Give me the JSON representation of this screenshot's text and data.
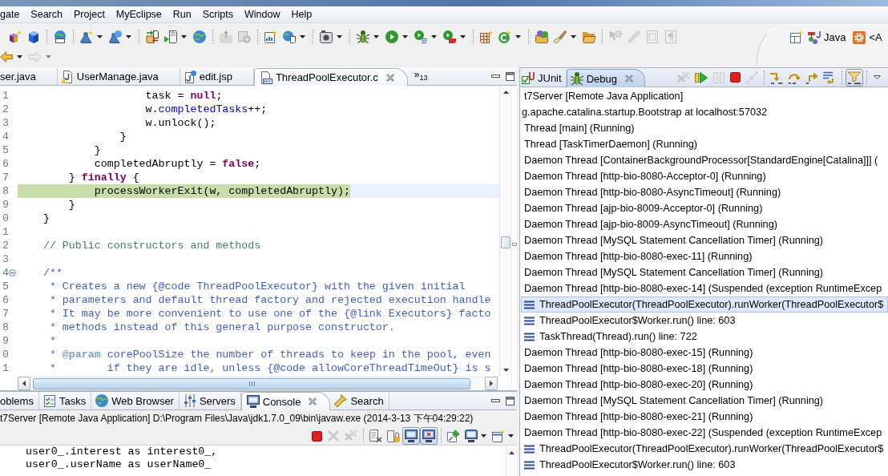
{
  "menu_bar": {
    "items": [
      "gate",
      "Search",
      "Project",
      "MyEclipse",
      "Run",
      "Scripts",
      "Window",
      "Help"
    ]
  },
  "main_toolbar": {
    "groups": [
      [
        {
          "disabled": false,
          "dropdown": false
        },
        {
          "disabled": false,
          "dropdown": false
        }
      ],
      [
        {
          "disabled": false,
          "dropdown": false
        }
      ],
      [
        {
          "disabled": false,
          "dropdown": true
        },
        {
          "disabled": false,
          "dropdown": true
        }
      ],
      [
        {
          "disabled": false,
          "dropdown": false
        },
        {
          "disabled": false,
          "dropdown": true
        },
        {
          "disabled": false,
          "dropdown": false
        }
      ],
      [
        {
          "disabled": true,
          "dropdown": false
        },
        {
          "disabled": true,
          "dropdown": false
        }
      ],
      [
        {
          "disabled": false,
          "dropdown": false
        },
        {
          "disabled": false,
          "dropdown": true
        }
      ],
      [
        {
          "disabled": false,
          "dropdown": true
        }
      ],
      [
        {
          "disabled": false,
          "dropdown": true
        },
        {
          "disabled": false,
          "dropdown": true
        },
        {
          "disabled": false,
          "dropdown": true
        },
        {
          "disabled": false,
          "dropdown": true
        }
      ],
      [
        {
          "disabled": false,
          "dropdown": false
        },
        {
          "disabled": false,
          "dropdown": true
        }
      ],
      [
        {
          "disabled": false,
          "dropdown": false
        },
        {
          "disabled": false,
          "dropdown": true
        },
        {
          "disabled": false,
          "dropdown": false
        }
      ],
      [
        {
          "disabled": true,
          "dropdown": false
        },
        {
          "disabled": true,
          "dropdown": false
        },
        {
          "disabled": true,
          "dropdown": false
        },
        {
          "disabled": true,
          "dropdown": false
        }
      ]
    ]
  },
  "navigation_toolbar": {
    "items": [
      {
        "disabled": false,
        "dropdown": true
      },
      {
        "disabled": true,
        "dropdown": true
      }
    ]
  },
  "perspective_bar": {
    "perspectives": [
      {
        "label": "Java"
      },
      {
        "label": "<A"
      }
    ]
  },
  "editor": {
    "tabs": [
      {
        "label": "ser.java",
        "selected": false
      },
      {
        "label": "UserManage.java",
        "selected": false
      },
      {
        "label": "edit.jsp",
        "selected": false
      },
      {
        "label": "ThreadPoolExecutor.c",
        "selected": true
      }
    ],
    "overflow": "»$_{13}$",
    "lines": [
      {
        "number": "1",
        "debug_highlight": false,
        "segments": [
          {
            "kind": "plain",
            "text": "                    task = "
          },
          {
            "kind": "keyword",
            "text": "null"
          },
          {
            "kind": "plain",
            "text": ";"
          }
        ]
      },
      {
        "number": "2",
        "debug_highlight": false,
        "segments": [
          {
            "kind": "plain",
            "text": "                    w."
          },
          {
            "kind": "field",
            "text": "completedTasks"
          },
          {
            "kind": "plain",
            "text": "++;"
          }
        ]
      },
      {
        "number": "3",
        "debug_highlight": false,
        "segments": [
          {
            "kind": "plain",
            "text": "                    w.unlock();"
          }
        ]
      },
      {
        "number": "4",
        "debug_highlight": false,
        "segments": [
          {
            "kind": "plain",
            "text": "                }"
          }
        ]
      },
      {
        "number": "5",
        "debug_highlight": false,
        "segments": [
          {
            "kind": "plain",
            "text": "            }"
          }
        ]
      },
      {
        "number": "6",
        "debug_highlight": false,
        "segments": [
          {
            "kind": "plain",
            "text": "            completedAbruptly = "
          },
          {
            "kind": "keyword",
            "text": "false"
          },
          {
            "kind": "plain",
            "text": ";"
          }
        ]
      },
      {
        "number": "7",
        "debug_highlight": false,
        "segments": [
          {
            "kind": "plain",
            "text": "        } "
          },
          {
            "kind": "keyword",
            "text": "finally"
          },
          {
            "kind": "plain",
            "text": " {"
          }
        ]
      },
      {
        "number": "8",
        "debug_highlight": true,
        "segments": [
          {
            "kind": "plain",
            "text": "            processWorkerExit(w, completedAbruptly);"
          }
        ]
      },
      {
        "number": "9",
        "debug_highlight": false,
        "segments": [
          {
            "kind": "plain",
            "text": "        }"
          }
        ]
      },
      {
        "number": "0",
        "debug_highlight": false,
        "segments": [
          {
            "kind": "plain",
            "text": "    }"
          }
        ]
      },
      {
        "number": "1",
        "debug_highlight": false
      },
      {
        "number": "2",
        "debug_highlight": false,
        "segments": [
          {
            "kind": "comment",
            "text": "    // Public constructors and methods"
          }
        ]
      },
      {
        "number": "3",
        "debug_highlight": false
      },
      {
        "number": "4",
        "debug_highlight": false,
        "fold_expanded": true,
        "segments": [
          {
            "kind": "javadoc",
            "text": "    /**"
          }
        ]
      },
      {
        "number": "5",
        "debug_highlight": false,
        "segments": [
          {
            "kind": "javadoc",
            "text": "     * Creates a new {@code ThreadPoolExecutor} with the given initial"
          }
        ]
      },
      {
        "number": "6",
        "debug_highlight": false,
        "segments": [
          {
            "kind": "javadoc",
            "text": "     * parameters and default thread factory and rejected execution handle"
          }
        ]
      },
      {
        "number": "7",
        "debug_highlight": false,
        "segments": [
          {
            "kind": "javadoc",
            "text": "     * It may be more convenient to use one of the {@link Executors} facto"
          }
        ]
      },
      {
        "number": "8",
        "debug_highlight": false,
        "segments": [
          {
            "kind": "javadoc",
            "text": "     * methods instead of this general purpose constructor."
          }
        ]
      },
      {
        "number": "9",
        "debug_highlight": false,
        "segments": [
          {
            "kind": "javadoc",
            "text": "     *"
          }
        ]
      },
      {
        "number": "0",
        "debug_highlight": false,
        "segments": [
          {
            "kind": "javadoc",
            "text": "     * "
          },
          {
            "kind": "javadoc_tag",
            "text": "@param"
          },
          {
            "kind": "javadoc",
            "text": " corePoolSize the number of threads to keep in the pool, even"
          }
        ]
      },
      {
        "number": "1",
        "debug_highlight": false,
        "segments": [
          {
            "kind": "javadoc",
            "text": "     *        if they are idle, unless {@code allowCoreThreadTimeOut} is s"
          }
        ]
      }
    ]
  },
  "debug_view": {
    "tabs": [
      {
        "label": "JUnit",
        "selected": false
      },
      {
        "label": "Debug",
        "selected": true
      }
    ],
    "toolbar": {
      "groups": [
        [
          {
            "disabled": true,
            "pressed": false
          },
          {
            "disabled": false,
            "pressed": false
          },
          {
            "disabled": true,
            "pressed": false
          },
          {
            "disabled": false,
            "pressed": false
          },
          {
            "disabled": true,
            "pressed": false
          }
        ],
        [
          {
            "disabled": false,
            "pressed": false
          },
          {
            "disabled": false,
            "pressed": false
          },
          {
            "disabled": false,
            "pressed": false
          },
          {
            "disabled": false,
            "pressed": false
          }
        ],
        [
          {
            "disabled": false,
            "pressed": true
          }
        ]
      ]
    },
    "tree": [
      {
        "kind": "launch",
        "label": "t7Server [Remote Java Application]",
        "selected": false,
        "children": [
          {
            "kind": "target",
            "label": "g.apache.catalina.startup.Bootstrap at localhost:57032",
            "selected": false,
            "children": [
              {
                "kind": "thread",
                "label": "Thread [main] (Running)",
                "selected": false
              },
              {
                "kind": "thread",
                "label": "Thread [TaskTimerDaemon] (Running)",
                "selected": false
              },
              {
                "kind": "thread",
                "label": "Daemon Thread [ContainerBackgroundProcessor[StandardEngine[Catalina]]] (",
                "selected": false
              },
              {
                "kind": "thread",
                "label": "Daemon Thread [http-bio-8080-Acceptor-0] (Running)",
                "selected": false
              },
              {
                "kind": "thread",
                "label": "Daemon Thread [http-bio-8080-AsyncTimeout] (Running)",
                "selected": false
              },
              {
                "kind": "thread",
                "label": "Daemon Thread [ajp-bio-8009-Acceptor-0] (Running)",
                "selected": false
              },
              {
                "kind": "thread",
                "label": "Daemon Thread [ajp-bio-8009-AsyncTimeout] (Running)",
                "selected": false
              },
              {
                "kind": "thread",
                "label": "Daemon Thread [MySQL Statement Cancellation Timer] (Running)",
                "selected": false
              },
              {
                "kind": "thread",
                "label": "Daemon Thread [http-bio-8080-exec-11] (Running)",
                "selected": false
              },
              {
                "kind": "thread",
                "label": "Daemon Thread [MySQL Statement Cancellation Timer] (Running)",
                "selected": false
              },
              {
                "kind": "thread",
                "label": "Daemon Thread [http-bio-8080-exec-14] (Suspended (exception RuntimeExcep",
                "selected": false,
                "children": [
                  {
                    "kind": "frame",
                    "label": "ThreadPoolExecutor(ThreadPoolExecutor).runWorker(ThreadPoolExecutor$",
                    "selected": true
                  },
                  {
                    "kind": "frame",
                    "label": "ThreadPoolExecutor$Worker.run() line: 603",
                    "selected": false
                  },
                  {
                    "kind": "frame",
                    "label": "TaskThread(Thread).run() line: 722",
                    "selected": false
                  }
                ]
              },
              {
                "kind": "thread",
                "label": "Daemon Thread [http-bio-8080-exec-15] (Running)",
                "selected": false
              },
              {
                "kind": "thread",
                "label": "Daemon Thread [http-bio-8080-exec-18] (Running)",
                "selected": false
              },
              {
                "kind": "thread",
                "label": "Daemon Thread [http-bio-8080-exec-20] (Running)",
                "selected": false
              },
              {
                "kind": "thread",
                "label": "Daemon Thread [MySQL Statement Cancellation Timer] (Running)",
                "selected": false
              },
              {
                "kind": "thread",
                "label": "Daemon Thread [http-bio-8080-exec-21] (Running)",
                "selected": false
              },
              {
                "kind": "thread",
                "label": "Daemon Thread [http-bio-8080-exec-22] (Suspended (exception RuntimeExcep",
                "selected": false,
                "children": [
                  {
                    "kind": "frame",
                    "label": "ThreadPoolExecutor(ThreadPoolExecutor).runWorker(ThreadPoolExecutor$",
                    "selected": false
                  },
                  {
                    "kind": "frame",
                    "label": "ThreadPoolExecutor$Worker.run() line: 603",
                    "selected": false
                  }
                ]
              }
            ]
          }
        ]
      }
    ]
  },
  "console_view": {
    "tabs": [
      {
        "label": "oblems",
        "selected": false
      },
      {
        "label": "Tasks",
        "selected": false
      },
      {
        "label": "Web Browser",
        "selected": false
      },
      {
        "label": "Servers",
        "selected": false
      },
      {
        "label": "Console",
        "selected": true
      },
      {
        "label": "Search",
        "selected": false
      }
    ],
    "process": "t7Server [Remote Java Application] D:\\Program Files\\Java\\jdk1.7.0_09\\bin\\javaw.exe (2014-3-13 下午04:29:22)",
    "toolbar": {
      "groups": [
        [
          {
            "disabled": false,
            "pressed": false,
            "dropdown": false
          },
          {
            "disabled": true,
            "pressed": false,
            "dropdown": false
          },
          {
            "disabled": true,
            "pressed": false,
            "dropdown": false
          }
        ],
        [
          {
            "disabled": false,
            "pressed": false,
            "dropdown": false
          },
          {
            "disabled": false,
            "pressed": false,
            "dropdown": false
          },
          {
            "disabled": false,
            "pressed": true,
            "dropdown": false
          },
          {
            "disabled": false,
            "pressed": true,
            "dropdown": false
          }
        ],
        [
          {
            "disabled": false,
            "pressed": false,
            "dropdown": false
          },
          {
            "disabled": false,
            "pressed": false,
            "dropdown": true
          },
          {
            "disabled": false,
            "pressed": false,
            "dropdown": true
          }
        ]
      ]
    },
    "output": [
      "    user0_.interest as interest0_,",
      "    user0_.userName as userName0_"
    ]
  }
}
